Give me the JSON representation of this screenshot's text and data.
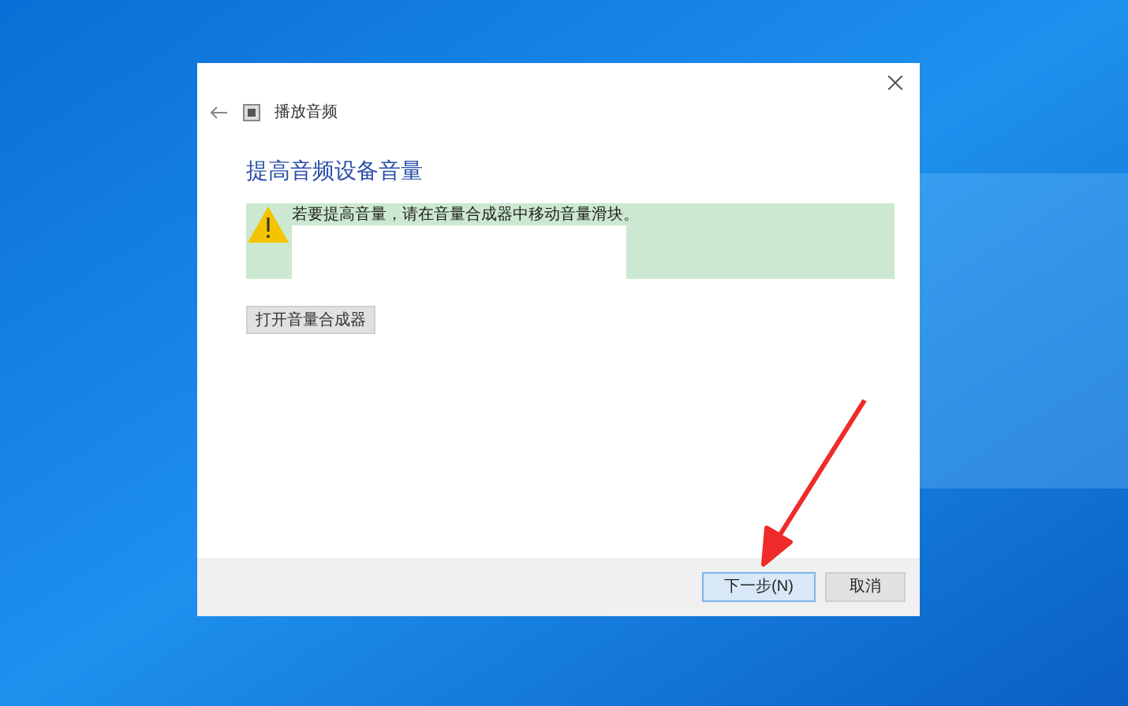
{
  "dialog": {
    "breadcrumb": "播放音频",
    "heading": "提高音频设备音量",
    "warning": "若要提高音量，请在音量合成器中移动音量滑块。",
    "open_mixer_button": "打开音量合成器"
  },
  "footer": {
    "buttons": [
      {
        "label": "下一步(N)",
        "selected": true
      },
      {
        "label": "取消",
        "selected": false
      }
    ]
  }
}
